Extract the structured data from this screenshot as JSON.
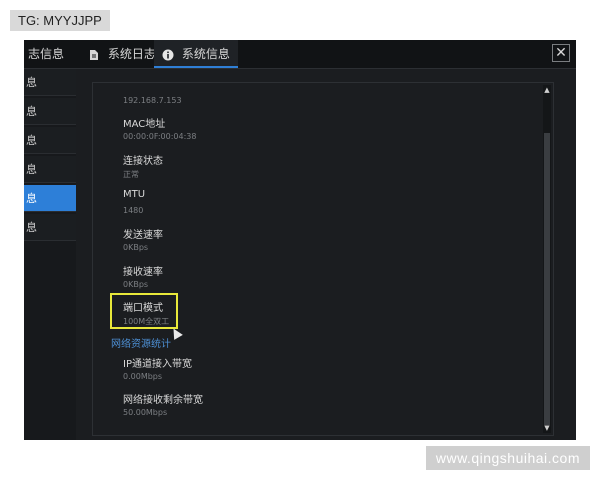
{
  "watermarks": {
    "top_left": "TG: MYYJJPP",
    "bottom_right": "www.qingshuihai.com"
  },
  "tabs": [
    {
      "label": "志信息",
      "icon": "none"
    },
    {
      "label": "系统日志",
      "icon": "document-icon"
    },
    {
      "label": "系统信息",
      "icon": "info-icon",
      "active": true
    }
  ],
  "close_label": "✕",
  "sidebar": {
    "items": [
      {
        "label": "息"
      },
      {
        "label": "息"
      },
      {
        "label": "息"
      },
      {
        "label": "息"
      },
      {
        "label": "息",
        "active": true
      },
      {
        "label": "息"
      }
    ]
  },
  "fields": [
    {
      "label": "",
      "value": "192.168.7.153"
    },
    {
      "label": "MAC地址",
      "value": "00:00:0F:00:04:38"
    },
    {
      "label": "连接状态",
      "value": "正常"
    },
    {
      "label": "MTU",
      "value": "1480"
    },
    {
      "label": "发送速率",
      "value": "0KBps"
    },
    {
      "label": "接收速率",
      "value": "0KBps"
    },
    {
      "label": "端口模式",
      "value": "100M全双工"
    }
  ],
  "section": {
    "title": "网络资源统计",
    "fields": [
      {
        "label": "IP通道接入带宽",
        "value": "0.00Mbps"
      },
      {
        "label": "网络接收剩余带宽",
        "value": "50.00Mbps"
      }
    ]
  },
  "colors": {
    "accent": "#2d7fd8",
    "highlight": "#e8e83a",
    "link": "#4d8fd4"
  }
}
